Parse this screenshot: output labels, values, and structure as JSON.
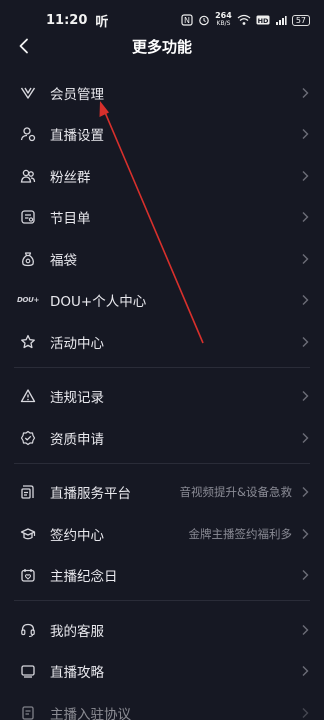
{
  "status_bar": {
    "time": "11:20",
    "carrier_glyph": "听",
    "net_speed": "264",
    "net_unit": "KB/S",
    "battery": "57"
  },
  "header": {
    "title": "更多功能"
  },
  "menu": {
    "group1": [
      {
        "label": "会员管理",
        "icon": "vip-v-icon"
      },
      {
        "label": "直播设置",
        "icon": "live-settings-icon"
      },
      {
        "label": "粉丝群",
        "icon": "fan-group-icon"
      },
      {
        "label": "节目单",
        "icon": "program-list-icon"
      },
      {
        "label": "福袋",
        "icon": "lucky-bag-icon"
      },
      {
        "label": "DOU+个人中心",
        "icon": "dou-plus-icon",
        "icon_text": "DOU+"
      },
      {
        "label": "活动中心",
        "icon": "star-icon"
      }
    ],
    "group2": [
      {
        "label": "违规记录",
        "icon": "warning-icon"
      },
      {
        "label": "资质申请",
        "icon": "badge-check-icon"
      }
    ],
    "group3": [
      {
        "label": "直播服务平台",
        "icon": "service-platform-icon",
        "sub": "音视频提升&设备急救"
      },
      {
        "label": "签约中心",
        "icon": "graduation-cap-icon",
        "sub": "金牌主播签约福利多"
      },
      {
        "label": "主播纪念日",
        "icon": "anniversary-calendar-icon"
      }
    ],
    "group4": [
      {
        "label": "我的客服",
        "icon": "headset-icon"
      },
      {
        "label": "直播攻略",
        "icon": "guide-tv-icon"
      },
      {
        "label": "主播入驻协议",
        "icon": "agreement-icon"
      }
    ]
  },
  "colors": {
    "background": "#161823",
    "text": "#e9e9ee",
    "subtext": "#8a8b95",
    "annotation_arrow": "#d8302c"
  }
}
